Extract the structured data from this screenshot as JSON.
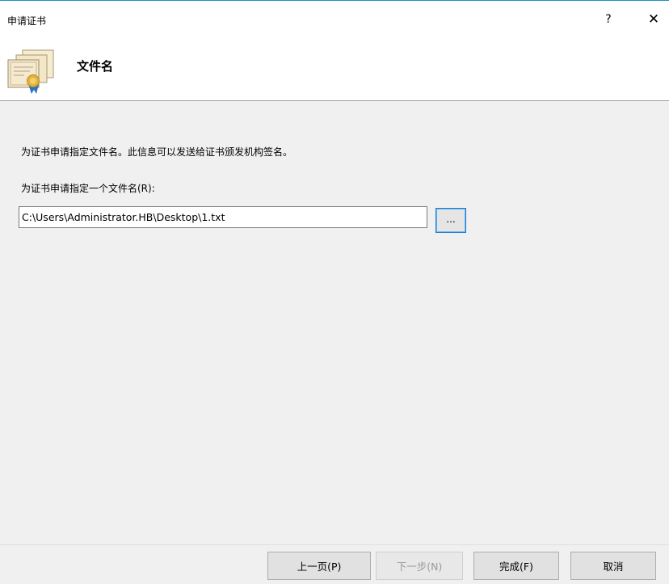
{
  "window": {
    "title": "申请证书",
    "help_label": "?",
    "close_label": "✕"
  },
  "header": {
    "title": "文件名",
    "icon": "certificate-icon"
  },
  "main": {
    "description": "为证书申请指定文件名。此信息可以发送给证书颁发机构签名。",
    "field_label": "为证书申请指定一个文件名(R):",
    "path_value": "C:\\Users\\Administrator.HB\\Desktop\\1.txt",
    "browse_label": "..."
  },
  "footer": {
    "back_label": "上一页(P)",
    "next_label": "下一步(N)",
    "finish_label": "完成(F)",
    "cancel_label": "取消"
  },
  "colors": {
    "accent": "#1a7fd4",
    "title_border": "#1e90c8"
  }
}
